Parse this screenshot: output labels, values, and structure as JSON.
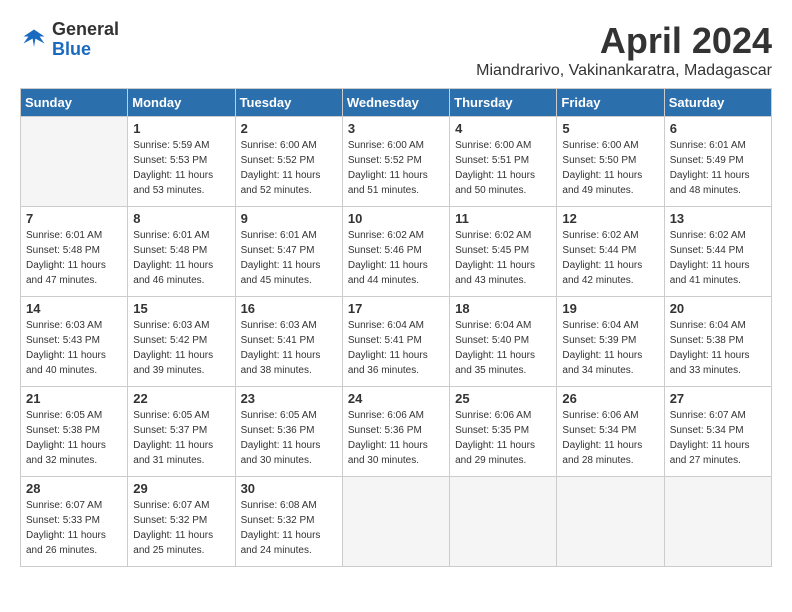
{
  "header": {
    "logo_general": "General",
    "logo_blue": "Blue",
    "month_title": "April 2024",
    "location": "Miandrarivo, Vakinankaratra, Madagascar"
  },
  "weekdays": [
    "Sunday",
    "Monday",
    "Tuesday",
    "Wednesday",
    "Thursday",
    "Friday",
    "Saturday"
  ],
  "weeks": [
    [
      {
        "day": "",
        "details": ""
      },
      {
        "day": "1",
        "details": "Sunrise: 5:59 AM\nSunset: 5:53 PM\nDaylight: 11 hours\nand 53 minutes."
      },
      {
        "day": "2",
        "details": "Sunrise: 6:00 AM\nSunset: 5:52 PM\nDaylight: 11 hours\nand 52 minutes."
      },
      {
        "day": "3",
        "details": "Sunrise: 6:00 AM\nSunset: 5:52 PM\nDaylight: 11 hours\nand 51 minutes."
      },
      {
        "day": "4",
        "details": "Sunrise: 6:00 AM\nSunset: 5:51 PM\nDaylight: 11 hours\nand 50 minutes."
      },
      {
        "day": "5",
        "details": "Sunrise: 6:00 AM\nSunset: 5:50 PM\nDaylight: 11 hours\nand 49 minutes."
      },
      {
        "day": "6",
        "details": "Sunrise: 6:01 AM\nSunset: 5:49 PM\nDaylight: 11 hours\nand 48 minutes."
      }
    ],
    [
      {
        "day": "7",
        "details": "Sunrise: 6:01 AM\nSunset: 5:48 PM\nDaylight: 11 hours\nand 47 minutes."
      },
      {
        "day": "8",
        "details": "Sunrise: 6:01 AM\nSunset: 5:48 PM\nDaylight: 11 hours\nand 46 minutes."
      },
      {
        "day": "9",
        "details": "Sunrise: 6:01 AM\nSunset: 5:47 PM\nDaylight: 11 hours\nand 45 minutes."
      },
      {
        "day": "10",
        "details": "Sunrise: 6:02 AM\nSunset: 5:46 PM\nDaylight: 11 hours\nand 44 minutes."
      },
      {
        "day": "11",
        "details": "Sunrise: 6:02 AM\nSunset: 5:45 PM\nDaylight: 11 hours\nand 43 minutes."
      },
      {
        "day": "12",
        "details": "Sunrise: 6:02 AM\nSunset: 5:44 PM\nDaylight: 11 hours\nand 42 minutes."
      },
      {
        "day": "13",
        "details": "Sunrise: 6:02 AM\nSunset: 5:44 PM\nDaylight: 11 hours\nand 41 minutes."
      }
    ],
    [
      {
        "day": "14",
        "details": "Sunrise: 6:03 AM\nSunset: 5:43 PM\nDaylight: 11 hours\nand 40 minutes."
      },
      {
        "day": "15",
        "details": "Sunrise: 6:03 AM\nSunset: 5:42 PM\nDaylight: 11 hours\nand 39 minutes."
      },
      {
        "day": "16",
        "details": "Sunrise: 6:03 AM\nSunset: 5:41 PM\nDaylight: 11 hours\nand 38 minutes."
      },
      {
        "day": "17",
        "details": "Sunrise: 6:04 AM\nSunset: 5:41 PM\nDaylight: 11 hours\nand 36 minutes."
      },
      {
        "day": "18",
        "details": "Sunrise: 6:04 AM\nSunset: 5:40 PM\nDaylight: 11 hours\nand 35 minutes."
      },
      {
        "day": "19",
        "details": "Sunrise: 6:04 AM\nSunset: 5:39 PM\nDaylight: 11 hours\nand 34 minutes."
      },
      {
        "day": "20",
        "details": "Sunrise: 6:04 AM\nSunset: 5:38 PM\nDaylight: 11 hours\nand 33 minutes."
      }
    ],
    [
      {
        "day": "21",
        "details": "Sunrise: 6:05 AM\nSunset: 5:38 PM\nDaylight: 11 hours\nand 32 minutes."
      },
      {
        "day": "22",
        "details": "Sunrise: 6:05 AM\nSunset: 5:37 PM\nDaylight: 11 hours\nand 31 minutes."
      },
      {
        "day": "23",
        "details": "Sunrise: 6:05 AM\nSunset: 5:36 PM\nDaylight: 11 hours\nand 30 minutes."
      },
      {
        "day": "24",
        "details": "Sunrise: 6:06 AM\nSunset: 5:36 PM\nDaylight: 11 hours\nand 30 minutes."
      },
      {
        "day": "25",
        "details": "Sunrise: 6:06 AM\nSunset: 5:35 PM\nDaylight: 11 hours\nand 29 minutes."
      },
      {
        "day": "26",
        "details": "Sunrise: 6:06 AM\nSunset: 5:34 PM\nDaylight: 11 hours\nand 28 minutes."
      },
      {
        "day": "27",
        "details": "Sunrise: 6:07 AM\nSunset: 5:34 PM\nDaylight: 11 hours\nand 27 minutes."
      }
    ],
    [
      {
        "day": "28",
        "details": "Sunrise: 6:07 AM\nSunset: 5:33 PM\nDaylight: 11 hours\nand 26 minutes."
      },
      {
        "day": "29",
        "details": "Sunrise: 6:07 AM\nSunset: 5:32 PM\nDaylight: 11 hours\nand 25 minutes."
      },
      {
        "day": "30",
        "details": "Sunrise: 6:08 AM\nSunset: 5:32 PM\nDaylight: 11 hours\nand 24 minutes."
      },
      {
        "day": "",
        "details": ""
      },
      {
        "day": "",
        "details": ""
      },
      {
        "day": "",
        "details": ""
      },
      {
        "day": "",
        "details": ""
      }
    ]
  ]
}
